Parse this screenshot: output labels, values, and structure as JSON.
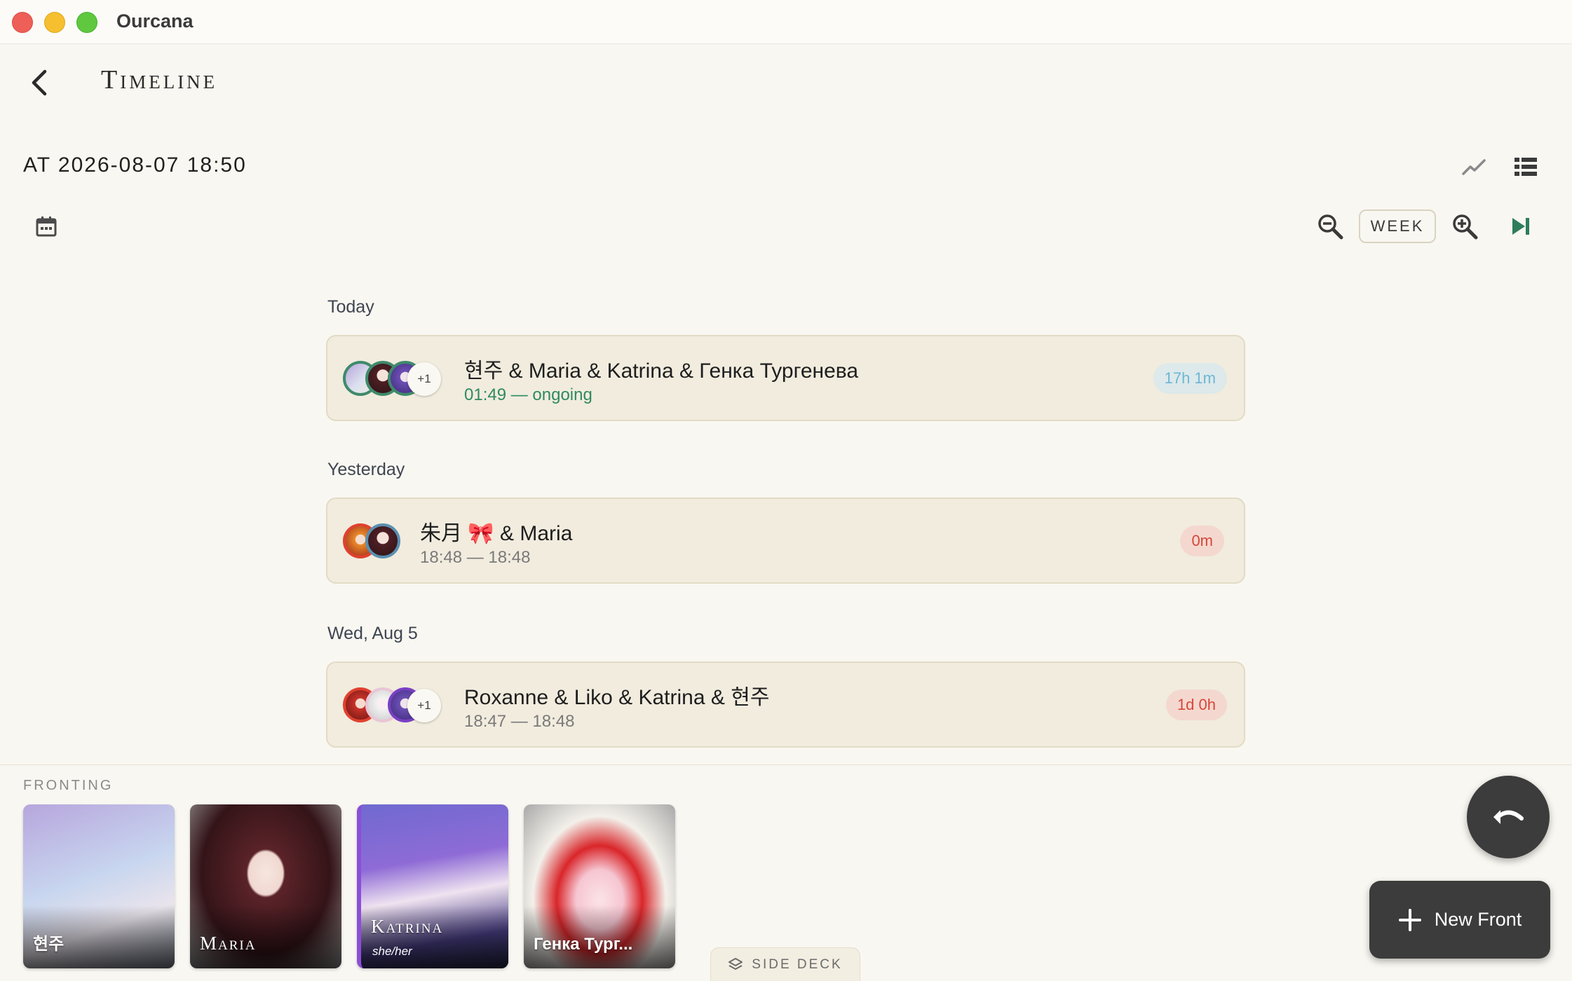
{
  "window": {
    "title": "Ourcana"
  },
  "header": {
    "title": "Timeline",
    "back_icon": "chevron-left-icon"
  },
  "toolbar": {
    "at_date": "AT 2026-08-07 18:50",
    "zoom_level": "WEEK",
    "icons": [
      "trend-icon",
      "list-icon",
      "calendar-icon",
      "zoom-out-icon",
      "zoom-in-icon",
      "skip-to-end-icon"
    ]
  },
  "timeline": [
    {
      "day": "Today",
      "entry": {
        "title": "현주 & Maria & Katrina & Генка Тургенева",
        "time": "01:49 — ongoing",
        "duration": "17h 1m",
        "more_count": "+1"
      }
    },
    {
      "day": "Yesterday",
      "entry": {
        "title": "朱月 🎀 & Maria",
        "time": "18:48 — 18:48",
        "duration": "0m"
      }
    },
    {
      "day": "Wed, Aug 5",
      "entry": {
        "title": "Roxanne & Liko & Katrina & 현주",
        "time": "18:47 — 18:48",
        "duration": "1d 0h",
        "more_count": "+1"
      }
    }
  ],
  "fronting": {
    "label": "FRONTING",
    "members": [
      {
        "name": "현주"
      },
      {
        "name": "Maria"
      },
      {
        "name": "Katrina",
        "pronouns": "she/her"
      },
      {
        "name": "Генка Тург..."
      }
    ]
  },
  "side_deck": {
    "label": "SIDE DECK"
  },
  "actions": {
    "new_front": "New Front",
    "undo_icon": "undo-icon"
  },
  "colors": {
    "background": "#f9f7f1",
    "card": "#f1ecde",
    "accent_green": "#3f8a6b",
    "badge_blue_text": "#6db6d6",
    "badge_red_text": "#d7463a",
    "fab": "#3c3c3c"
  }
}
